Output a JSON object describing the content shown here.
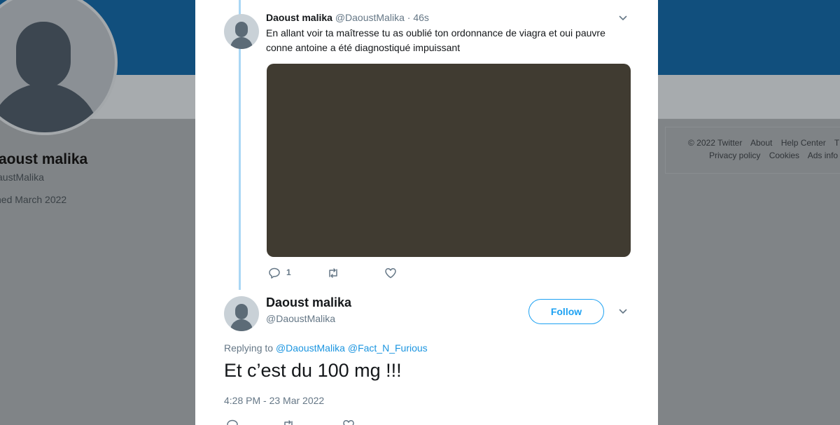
{
  "background_profile": {
    "name": "aoust malika",
    "handle": "austMalika",
    "joined": "ned March 2022"
  },
  "footer": {
    "row1": [
      "© 2022 Twitter",
      "About",
      "Help Center",
      "T"
    ],
    "row2": [
      "Privacy policy",
      "Cookies",
      "Ads info"
    ]
  },
  "parent_tweet": {
    "name": "Daoust malika",
    "handle": "@DaoustMalika",
    "separator": "·",
    "time": "46s",
    "text": "En allant voir ta maîtresse tu as oublié ton ordonnance de viagra et oui pauvre conne antoine a été diagnostiqué impuissant",
    "reply_count": "1",
    "media_color": "#403b31"
  },
  "main_tweet": {
    "name": "Daoust malika",
    "handle": "@DaoustMalika",
    "follow_label": "Follow",
    "replying_prefix": "Replying to",
    "mentions": [
      "@DaoustMalika",
      "@Fact_N_Furious"
    ],
    "text": "Et c’est du 100 mg !!!",
    "timestamp": "4:28 PM - 23 Mar 2022"
  },
  "icons": [
    "reply-icon",
    "retweet-icon",
    "like-icon",
    "chevron-down-icon"
  ],
  "colors": {
    "accent": "#1da1f2",
    "banner": "#114f7d",
    "thread_line": "#aad7f5",
    "secondary_text": "#657786"
  }
}
